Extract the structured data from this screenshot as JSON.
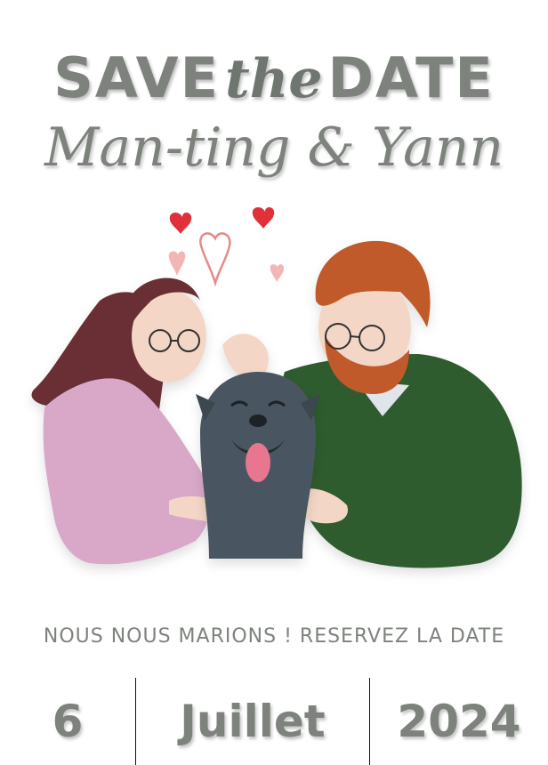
{
  "header": {
    "save": "SAVE",
    "the": "the",
    "date": "DATE",
    "names": "Man-ting & Yann"
  },
  "illustration": {
    "description_icon": "couple-with-dog-illustration-icon",
    "heart_color": "#e0303a",
    "left_person_hair": "#6b2f35",
    "left_person_top": "#d9a8c9",
    "right_person_hair": "#c05a2c",
    "right_person_sweater": "#2f5b2d",
    "dog_color": "#4a5560"
  },
  "tagline": "NOUS NOUS MARIONS ! RESERVEZ LA DATE",
  "date": {
    "day": "6",
    "month": "Juillet",
    "year": "2024"
  },
  "colors": {
    "text": "#7d837c",
    "divider": "#111111",
    "background": "#ffffff"
  }
}
